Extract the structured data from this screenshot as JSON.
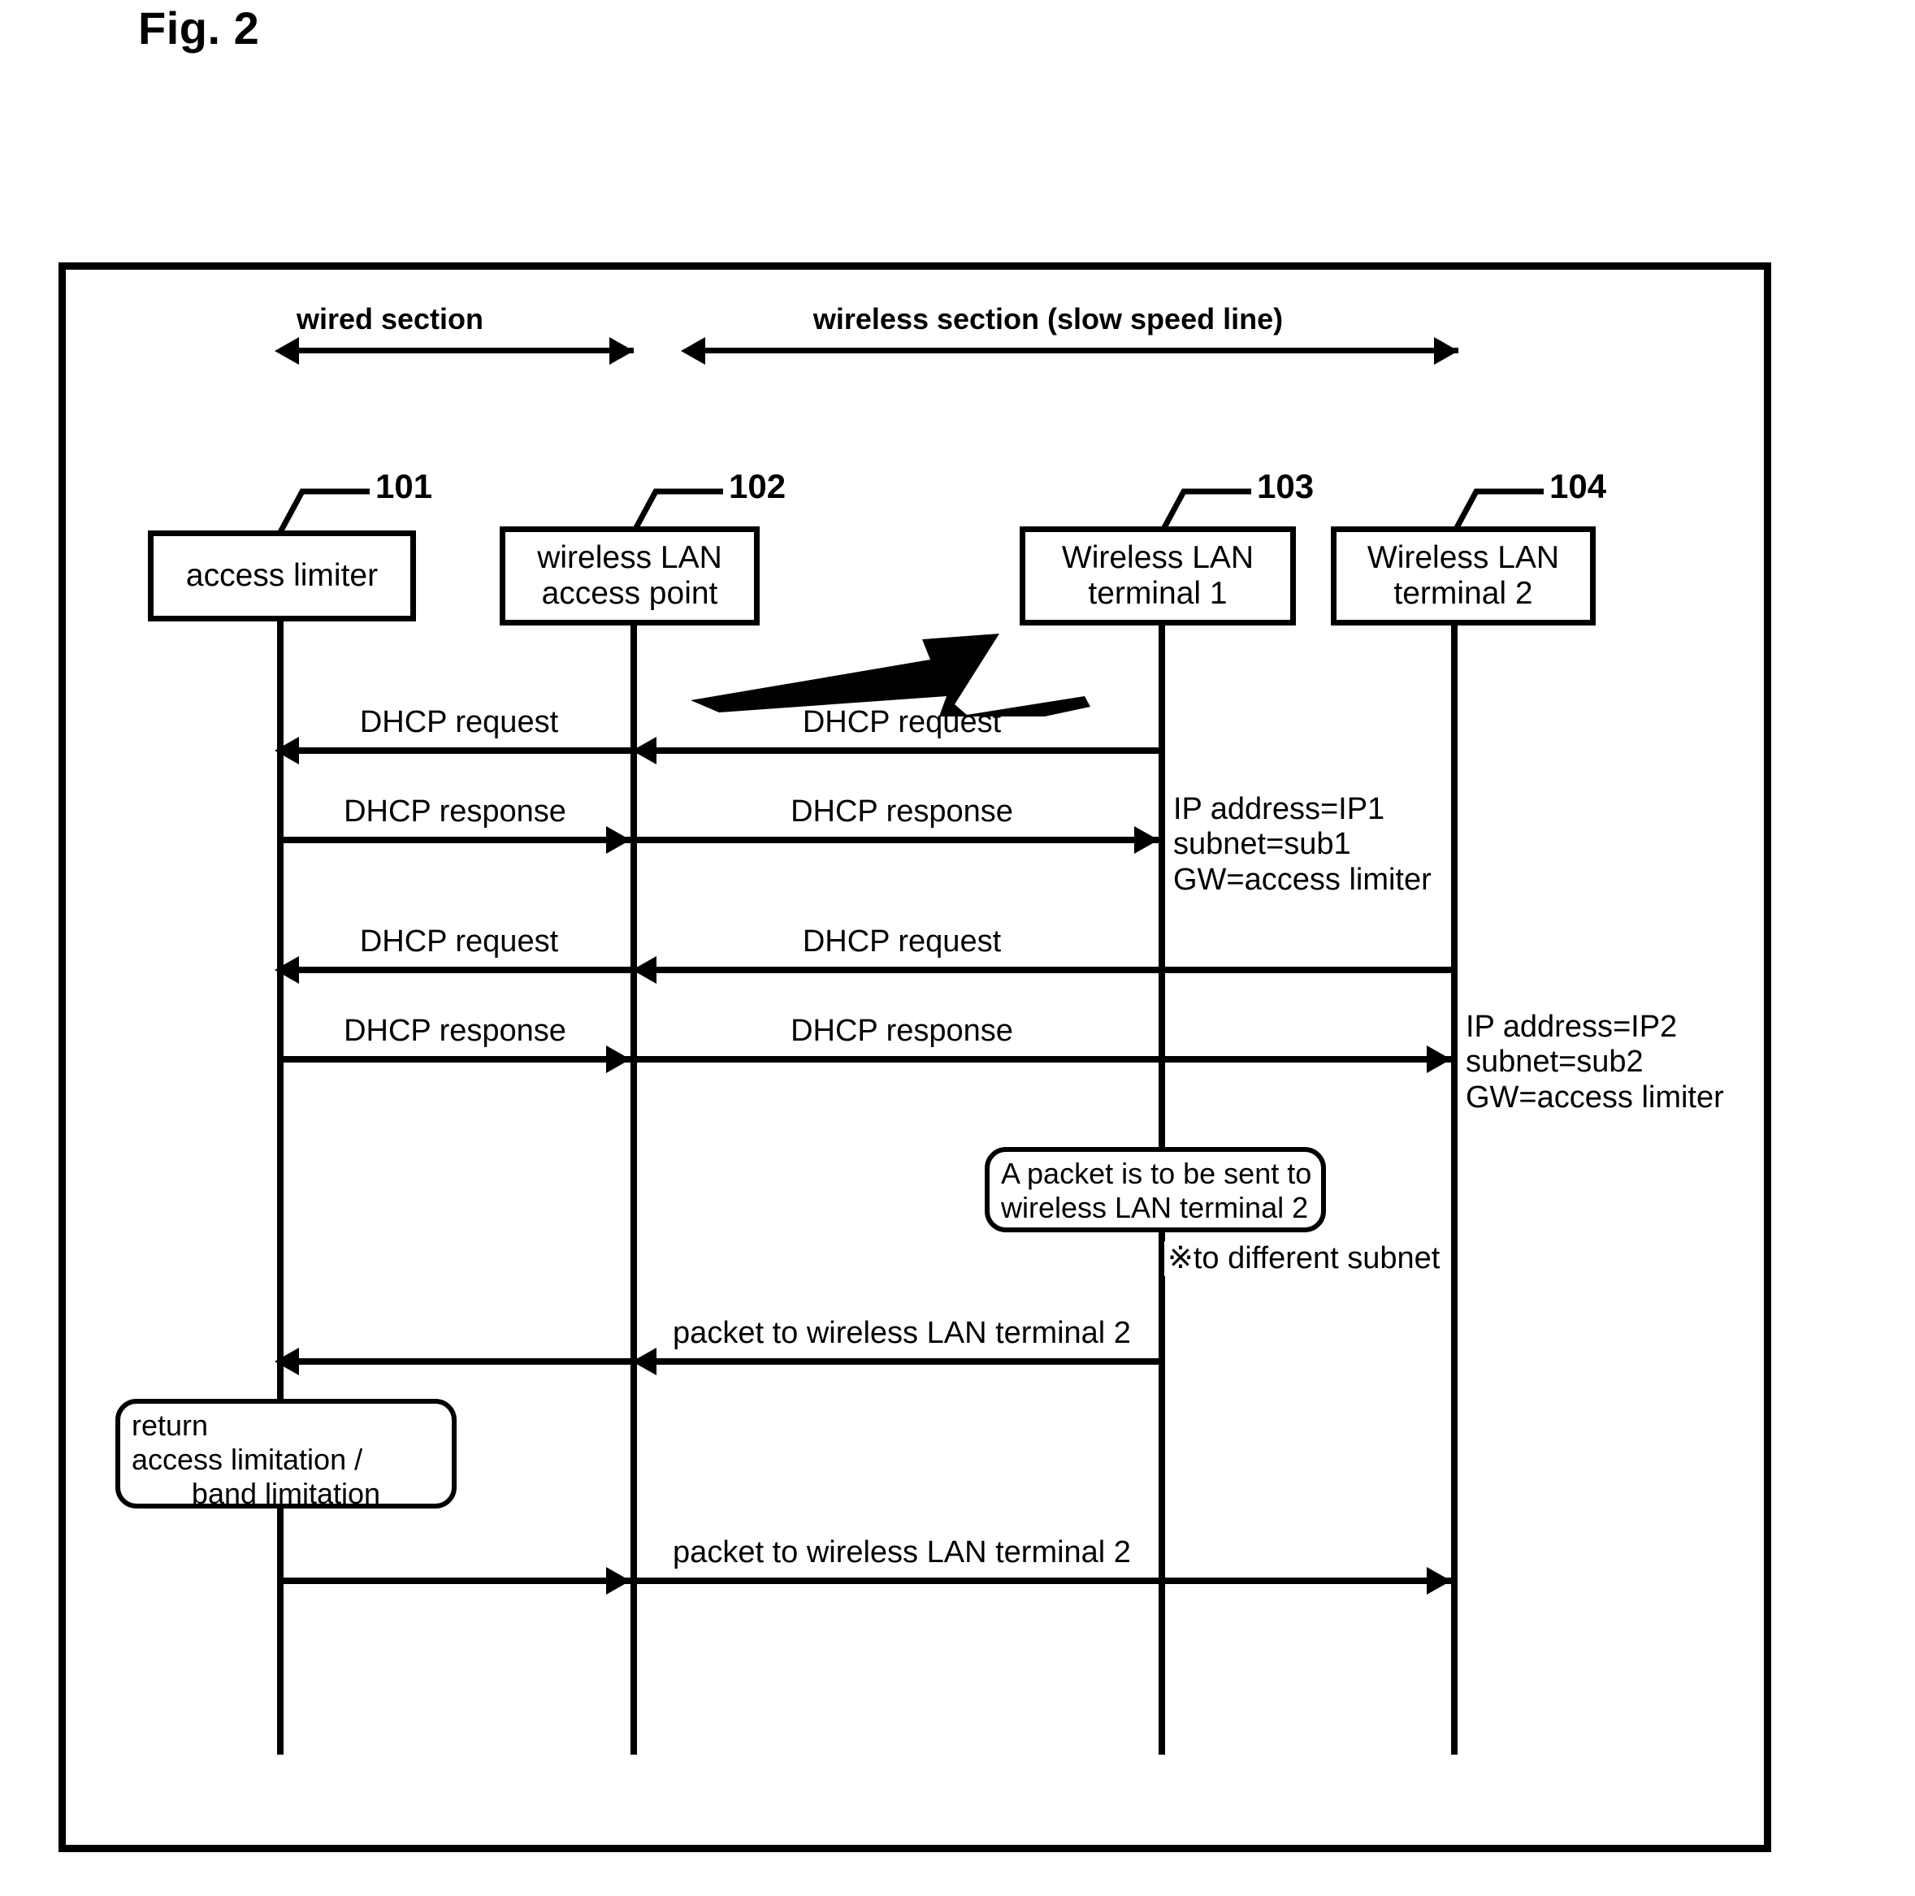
{
  "figure": {
    "title": "Fig. 2"
  },
  "sections": [
    {
      "label": "wired section"
    },
    {
      "label": "wireless section (slow speed line)"
    }
  ],
  "nodes": [
    {
      "ref": "101",
      "lines": [
        "access limiter"
      ]
    },
    {
      "ref": "102",
      "lines": [
        "wireless LAN",
        "access point"
      ]
    },
    {
      "ref": "103",
      "lines": [
        "Wireless LAN",
        "terminal 1"
      ]
    },
    {
      "ref": "104",
      "lines": [
        "Wireless LAN",
        "terminal 2"
      ]
    }
  ],
  "messages": [
    {
      "label": "DHCP request"
    },
    {
      "label": "DHCP request"
    },
    {
      "label": "DHCP response"
    },
    {
      "label": "DHCP response"
    },
    {
      "label": "DHCP request"
    },
    {
      "label": "DHCP request"
    },
    {
      "label": "DHCP response"
    },
    {
      "label": "DHCP response"
    },
    {
      "label": "packet to wireless LAN terminal 2"
    },
    {
      "label": "packet to wireless LAN terminal 2"
    }
  ],
  "annotations": {
    "terminal1_config": {
      "line1": "IP address=IP1",
      "line2": "subnet=sub1",
      "line3": "GW=access limiter"
    },
    "terminal2_config": {
      "line1": "IP address=IP2",
      "line2": "subnet=sub2",
      "line3": "GW=access limiter"
    },
    "packet_note": {
      "line1": "A packet is to be sent to",
      "line2": "wireless LAN terminal 2"
    },
    "subnet_note": "※to different subnet",
    "limitation_note": {
      "line1": "return",
      "line2": "access limitation /",
      "line3": "band limitation"
    }
  },
  "icons": {
    "wireless_link": "lightning-bolt-icon"
  }
}
